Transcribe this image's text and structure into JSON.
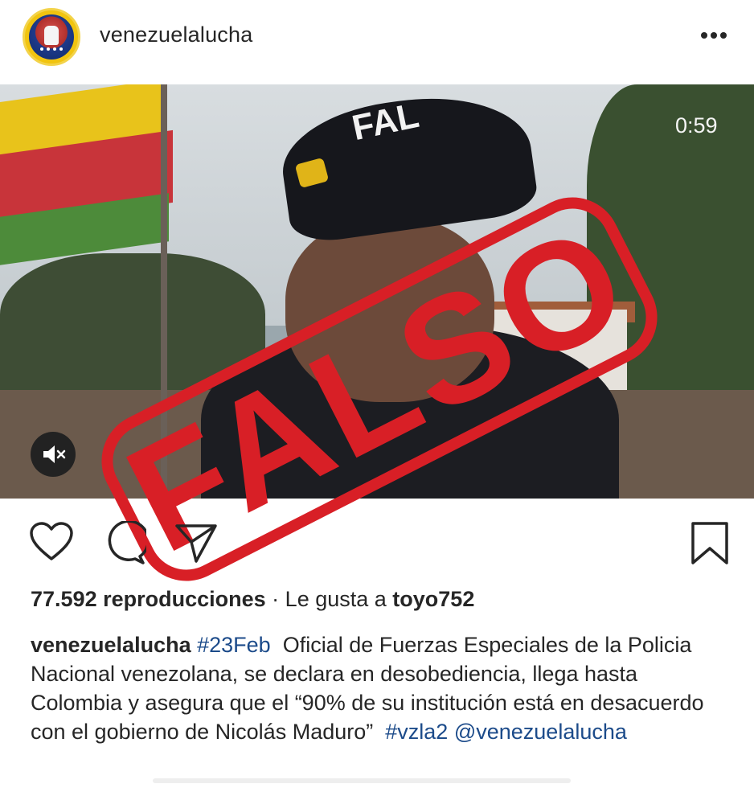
{
  "post": {
    "username": "venezuelalucha",
    "video_timer": "0:59",
    "stamp_text": "FALSO",
    "cap_text": "FAL",
    "views": "77.592 reproducciones",
    "separator": "·",
    "liked_by_prefix": "Le gusta a",
    "liked_by_user": "toyo752",
    "caption_username": "venezuelalucha",
    "caption_hashtag": "#23Feb",
    "caption_text": "Oficial de Fuerzas Especiales de la Policia Nacional venezolana, se declara en desobediencia, llega hasta Colombia y asegura que el “90% de su institución está en desacuerdo con el gobierno de Nicolás Maduro”",
    "caption_hashtag_2": "#vzla2",
    "caption_mention": "@venezuelalucha"
  },
  "colors": {
    "stamp_red": "#d81f26",
    "link_blue": "#1c4b8a",
    "text": "#262626"
  },
  "icons": [
    "more-options-icon",
    "mute-icon",
    "heart-icon",
    "comment-icon",
    "share-icon",
    "bookmark-icon"
  ]
}
